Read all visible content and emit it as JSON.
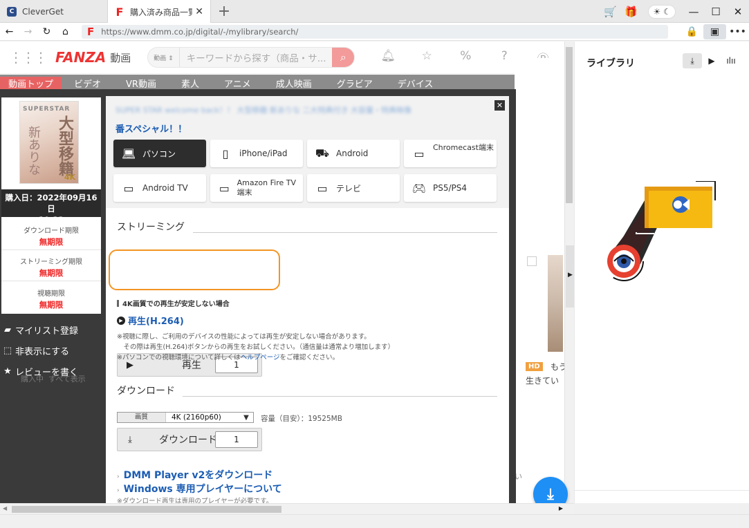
{
  "tabs": [
    {
      "title": "CleverGet",
      "fav": "C"
    },
    {
      "title": "購入済み商品一覧",
      "fav": "F"
    }
  ],
  "address": {
    "url": "https://www.dmm.co.jp/digital/-/mylibrary/search/",
    "fav": "F"
  },
  "site": {
    "logo": "FANZA",
    "logo_sub": "動画",
    "search_category": "動画 ⇕",
    "search_placeholder": "キーワードから探す（商品・サ...",
    "nav": [
      "動画トップ",
      "ビデオ",
      "VR動画",
      "素人",
      "アニメ",
      "成人映画",
      "グラビア",
      "デバイス"
    ]
  },
  "info": {
    "cover_text": {
      "top": "SUPERSTAR",
      "right": "大型移籍",
      "left": "新ありな",
      "badge": "4K"
    },
    "purchase": "購入日：2022年09月16日",
    "purchase_time": "19:22",
    "limits": [
      {
        "label": "ダウンロード期限",
        "value": "無期限"
      },
      {
        "label": "ストリーミング期限",
        "value": "無期限"
      },
      {
        "label": "視聴期限",
        "value": "無期限"
      }
    ],
    "actions": [
      "マイリスト登録",
      "非表示にする",
      "レビューを書く"
    ],
    "ghost": {
      "a": "購入中",
      "b": "すべて表示"
    }
  },
  "modal": {
    "blur_title": "SUPER STAR welcome back！！ 大型移籍 新ありな 二大特典付き 大容量・特典映像",
    "title": "番スペシャル！！",
    "devices": [
      {
        "label": "パソコン",
        "icon": "laptop-icon"
      },
      {
        "label": "iPhone/iPad",
        "icon": "phone-icon"
      },
      {
        "label": "Android",
        "icon": "android-icon"
      },
      {
        "label": "Chromecast端末",
        "icon": "tv-icon"
      },
      {
        "label": "Android TV",
        "icon": "tv-icon"
      },
      {
        "label": "Amazon Fire TV 端末",
        "icon": "tv-icon"
      },
      {
        "label": "テレビ",
        "icon": "tv-icon"
      },
      {
        "label": "PS5/PS4",
        "icon": "gamepad-icon"
      }
    ],
    "streaming": {
      "heading": "ストリーミング",
      "play": "再生",
      "count": "1",
      "note4k": "4K画質での再生が安定しない場合",
      "h264": "再生(H.264)",
      "fine1": "※視聴に際し、ご利用のデバイスの性能によっては再生が安定しない場合があります。",
      "fine2": "　その際は再生(H.264)ボタンからの再生をお試しください。（通信量は通常より増加します）",
      "fine3a": "※パソコンでの視聴環境について詳しくは",
      "fine3link": "ヘルプページ",
      "fine3b": "をご確認ください。"
    },
    "download": {
      "heading": "ダウンロード",
      "quality_label": "画質",
      "quality_value": "4K (2160p60)",
      "capacity": "容量（目安）：19525MB",
      "button": "ダウンロード",
      "count": "1",
      "link1": "DMM Player v2をダウンロード",
      "link2": "Windows 専用プレイヤーについて",
      "fine": "※ダウンロード再生は専用のプレイヤーが必要です。"
    }
  },
  "site_right": {
    "hd": "HD",
    "t1": "もう",
    "t2": "生きてい",
    "t3": "い"
  },
  "library": {
    "title": "ライブラリ"
  },
  "colors": {
    "accent": "#1e8ff5",
    "orange": "#f39422",
    "link": "#1c5db3",
    "red": "#e22222"
  }
}
